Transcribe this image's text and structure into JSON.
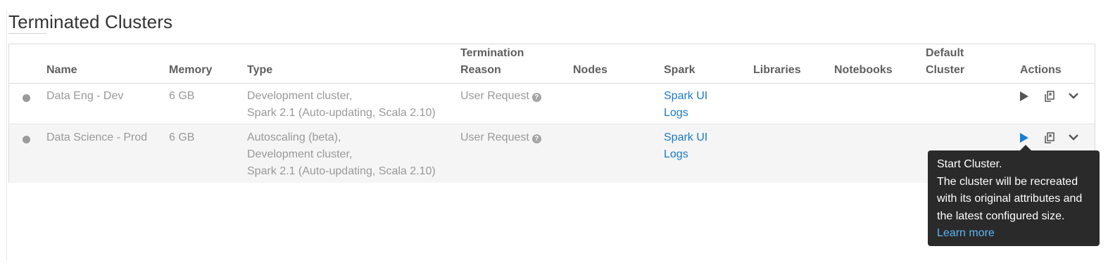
{
  "page": {
    "title": "Terminated Clusters"
  },
  "columns": {
    "name": "Name",
    "memory": "Memory",
    "type": "Type",
    "termination_line1": "Termination",
    "termination_line2": "Reason",
    "nodes": "Nodes",
    "spark": "Spark",
    "libraries": "Libraries",
    "notebooks": "Notebooks",
    "default_line1": "Default",
    "default_line2": "Cluster",
    "actions": "Actions"
  },
  "rows": [
    {
      "name": "Data Eng - Dev",
      "memory": "6 GB",
      "type_lines": [
        "Development cluster,",
        "Spark 2.1 (Auto-updating, Scala 2.10)"
      ],
      "termination_reason": "User Request",
      "spark_ui": "Spark UI",
      "logs": "Logs",
      "start_icon_color": "#555555"
    },
    {
      "name": "Data Science - Prod",
      "memory": "6 GB",
      "type_lines": [
        "Autoscaling (beta),",
        "Development cluster,",
        "Spark 2.1 (Auto-updating, Scala 2.10)"
      ],
      "termination_reason": "User Request",
      "spark_ui": "Spark UI",
      "logs": "Logs",
      "start_icon_color": "#1a7fd4"
    }
  ],
  "tooltip": {
    "title": "Start Cluster.",
    "lines": [
      "The cluster will be recreated",
      "with its original attributes and",
      "the latest configured size."
    ],
    "link": "Learn more"
  },
  "icons": {
    "status": "status-dot-icon",
    "help": "question-circle-icon",
    "start": "play-icon",
    "clone": "clone-icon",
    "more": "chevron-down-icon"
  },
  "colors": {
    "link": "#1a79c9",
    "tooltip_bg": "#2a2a2a",
    "tooltip_link": "#5bb6f5",
    "start_active": "#1a7fd4"
  }
}
